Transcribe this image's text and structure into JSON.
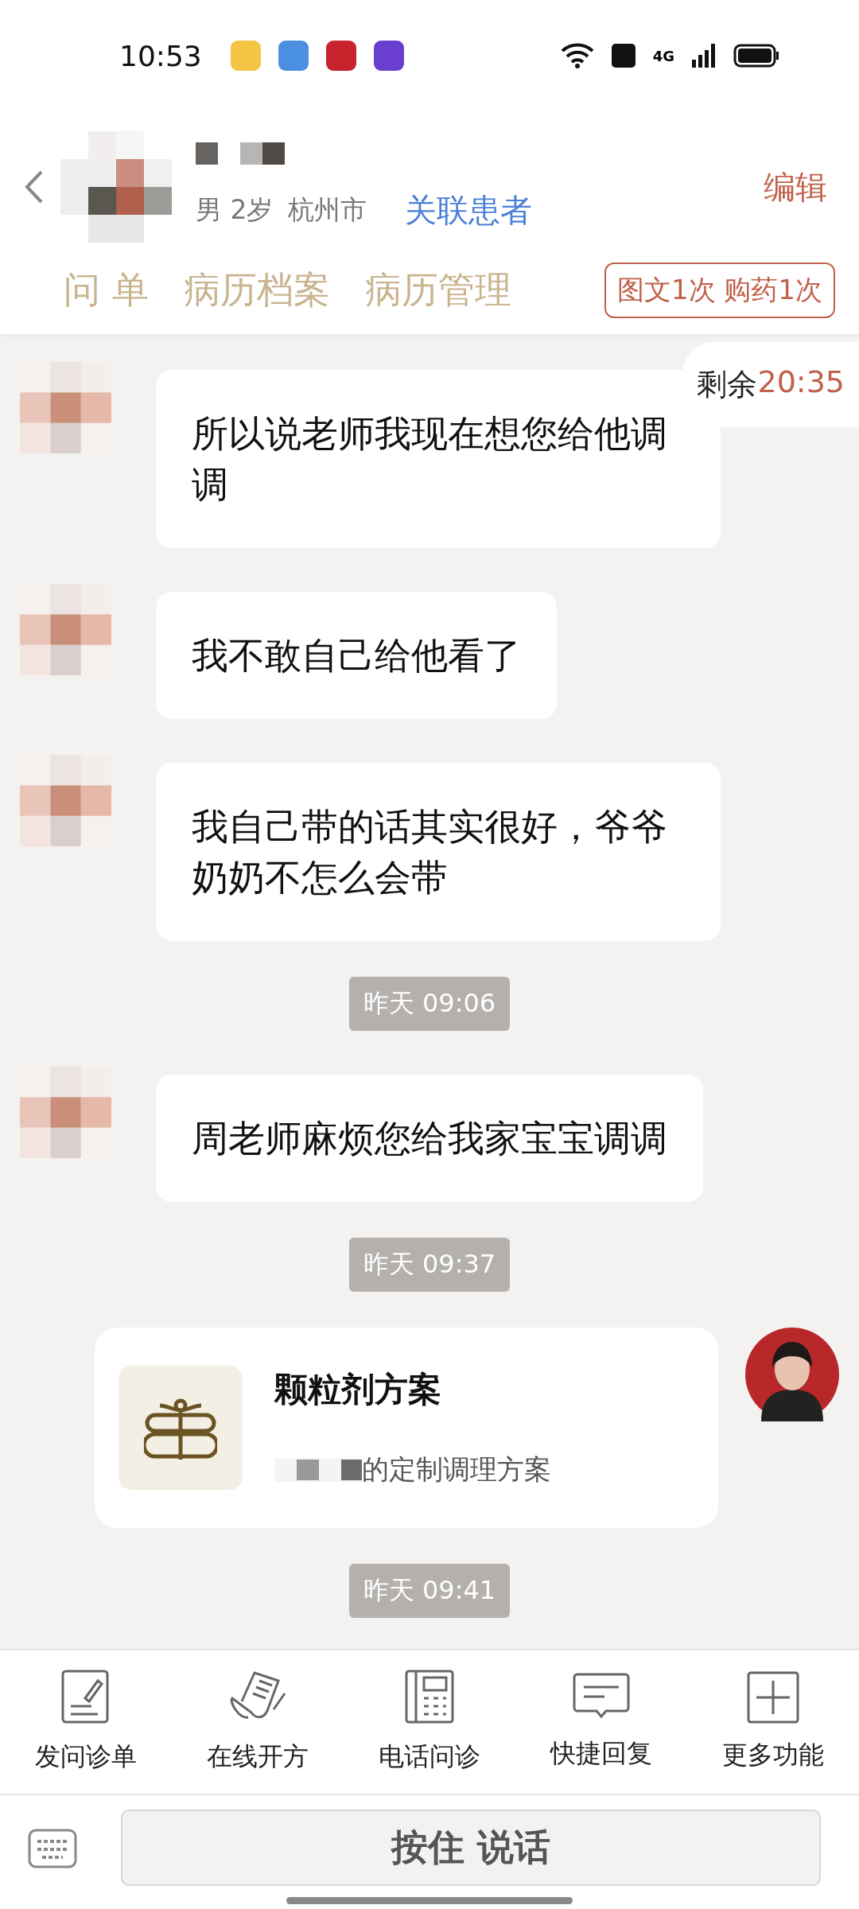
{
  "status_bar": {
    "time": "10:53",
    "network": "4G"
  },
  "header": {
    "info": [
      "男 2岁",
      "杭州市"
    ],
    "link": "关联患者",
    "edit": "编辑"
  },
  "tabs": [
    "问 单",
    "病历档案",
    "病历管理"
  ],
  "quota": "图文1次 购药1次",
  "timer": {
    "label": "剩余",
    "value": "20:35"
  },
  "messages": [
    {
      "kind": "text",
      "text": "所以说老师我现在想您给他调调"
    },
    {
      "kind": "text",
      "text": "我不敢自己给他看了"
    },
    {
      "kind": "text",
      "text": "我自己带的话其实很好，爷爷奶奶不怎么会带"
    },
    {
      "kind": "time",
      "text": "昨天 09:06"
    },
    {
      "kind": "text",
      "text": "周老师麻烦您给我家宝宝调调"
    },
    {
      "kind": "time",
      "text": "昨天 09:37"
    },
    {
      "kind": "card",
      "title": "颗粒剂方案",
      "subtitle": "的定制调理方案"
    },
    {
      "kind": "time",
      "text": "昨天 09:41"
    }
  ],
  "tools": [
    "发问诊单",
    "在线开方",
    "电话问诊",
    "快捷回复",
    "更多功能"
  ],
  "voice_button": "按住 说话"
}
